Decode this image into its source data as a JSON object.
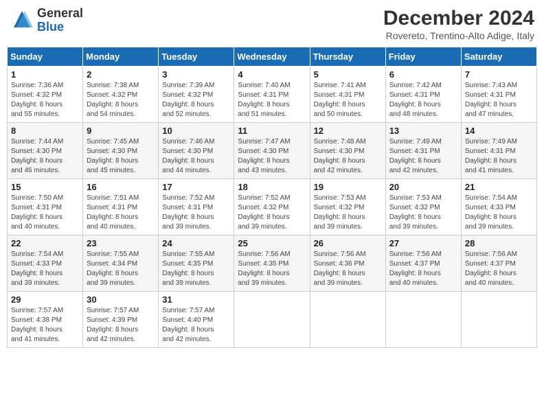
{
  "header": {
    "logo_general": "General",
    "logo_blue": "Blue",
    "title": "December 2024",
    "location": "Rovereto, Trentino-Alto Adige, Italy"
  },
  "weekdays": [
    "Sunday",
    "Monday",
    "Tuesday",
    "Wednesday",
    "Thursday",
    "Friday",
    "Saturday"
  ],
  "weeks": [
    [
      {
        "day": "1",
        "info": "Sunrise: 7:36 AM\nSunset: 4:32 PM\nDaylight: 8 hours\nand 55 minutes."
      },
      {
        "day": "2",
        "info": "Sunrise: 7:38 AM\nSunset: 4:32 PM\nDaylight: 8 hours\nand 54 minutes."
      },
      {
        "day": "3",
        "info": "Sunrise: 7:39 AM\nSunset: 4:32 PM\nDaylight: 8 hours\nand 52 minutes."
      },
      {
        "day": "4",
        "info": "Sunrise: 7:40 AM\nSunset: 4:31 PM\nDaylight: 8 hours\nand 51 minutes."
      },
      {
        "day": "5",
        "info": "Sunrise: 7:41 AM\nSunset: 4:31 PM\nDaylight: 8 hours\nand 50 minutes."
      },
      {
        "day": "6",
        "info": "Sunrise: 7:42 AM\nSunset: 4:31 PM\nDaylight: 8 hours\nand 48 minutes."
      },
      {
        "day": "7",
        "info": "Sunrise: 7:43 AM\nSunset: 4:31 PM\nDaylight: 8 hours\nand 47 minutes."
      }
    ],
    [
      {
        "day": "8",
        "info": "Sunrise: 7:44 AM\nSunset: 4:30 PM\nDaylight: 8 hours\nand 46 minutes."
      },
      {
        "day": "9",
        "info": "Sunrise: 7:45 AM\nSunset: 4:30 PM\nDaylight: 8 hours\nand 45 minutes."
      },
      {
        "day": "10",
        "info": "Sunrise: 7:46 AM\nSunset: 4:30 PM\nDaylight: 8 hours\nand 44 minutes."
      },
      {
        "day": "11",
        "info": "Sunrise: 7:47 AM\nSunset: 4:30 PM\nDaylight: 8 hours\nand 43 minutes."
      },
      {
        "day": "12",
        "info": "Sunrise: 7:48 AM\nSunset: 4:30 PM\nDaylight: 8 hours\nand 42 minutes."
      },
      {
        "day": "13",
        "info": "Sunrise: 7:49 AM\nSunset: 4:31 PM\nDaylight: 8 hours\nand 42 minutes."
      },
      {
        "day": "14",
        "info": "Sunrise: 7:49 AM\nSunset: 4:31 PM\nDaylight: 8 hours\nand 41 minutes."
      }
    ],
    [
      {
        "day": "15",
        "info": "Sunrise: 7:50 AM\nSunset: 4:31 PM\nDaylight: 8 hours\nand 40 minutes."
      },
      {
        "day": "16",
        "info": "Sunrise: 7:51 AM\nSunset: 4:31 PM\nDaylight: 8 hours\nand 40 minutes."
      },
      {
        "day": "17",
        "info": "Sunrise: 7:52 AM\nSunset: 4:31 PM\nDaylight: 8 hours\nand 39 minutes."
      },
      {
        "day": "18",
        "info": "Sunrise: 7:52 AM\nSunset: 4:32 PM\nDaylight: 8 hours\nand 39 minutes."
      },
      {
        "day": "19",
        "info": "Sunrise: 7:53 AM\nSunset: 4:32 PM\nDaylight: 8 hours\nand 39 minutes."
      },
      {
        "day": "20",
        "info": "Sunrise: 7:53 AM\nSunset: 4:32 PM\nDaylight: 8 hours\nand 39 minutes."
      },
      {
        "day": "21",
        "info": "Sunrise: 7:54 AM\nSunset: 4:33 PM\nDaylight: 8 hours\nand 39 minutes."
      }
    ],
    [
      {
        "day": "22",
        "info": "Sunrise: 7:54 AM\nSunset: 4:33 PM\nDaylight: 8 hours\nand 39 minutes."
      },
      {
        "day": "23",
        "info": "Sunrise: 7:55 AM\nSunset: 4:34 PM\nDaylight: 8 hours\nand 39 minutes."
      },
      {
        "day": "24",
        "info": "Sunrise: 7:55 AM\nSunset: 4:35 PM\nDaylight: 8 hours\nand 39 minutes."
      },
      {
        "day": "25",
        "info": "Sunrise: 7:56 AM\nSunset: 4:35 PM\nDaylight: 8 hours\nand 39 minutes."
      },
      {
        "day": "26",
        "info": "Sunrise: 7:56 AM\nSunset: 4:36 PM\nDaylight: 8 hours\nand 39 minutes."
      },
      {
        "day": "27",
        "info": "Sunrise: 7:56 AM\nSunset: 4:37 PM\nDaylight: 8 hours\nand 40 minutes."
      },
      {
        "day": "28",
        "info": "Sunrise: 7:56 AM\nSunset: 4:37 PM\nDaylight: 8 hours\nand 40 minutes."
      }
    ],
    [
      {
        "day": "29",
        "info": "Sunrise: 7:57 AM\nSunset: 4:38 PM\nDaylight: 8 hours\nand 41 minutes."
      },
      {
        "day": "30",
        "info": "Sunrise: 7:57 AM\nSunset: 4:39 PM\nDaylight: 8 hours\nand 42 minutes."
      },
      {
        "day": "31",
        "info": "Sunrise: 7:57 AM\nSunset: 4:40 PM\nDaylight: 8 hours\nand 42 minutes."
      },
      null,
      null,
      null,
      null
    ]
  ]
}
